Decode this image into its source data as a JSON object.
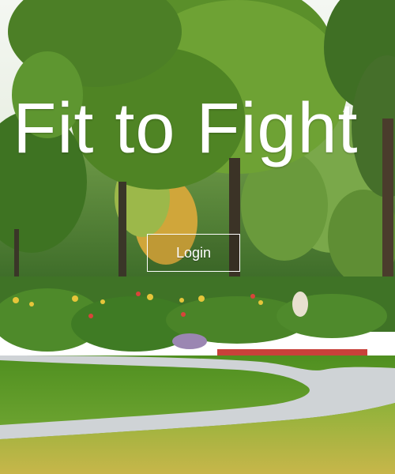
{
  "hero": {
    "title": "Fit to Fight",
    "login_label": "Login"
  },
  "colors": {
    "text": "#ffffff",
    "grass": "#5e9b2a",
    "path": "#cfd3d6",
    "sky": "#f2f5f2"
  }
}
